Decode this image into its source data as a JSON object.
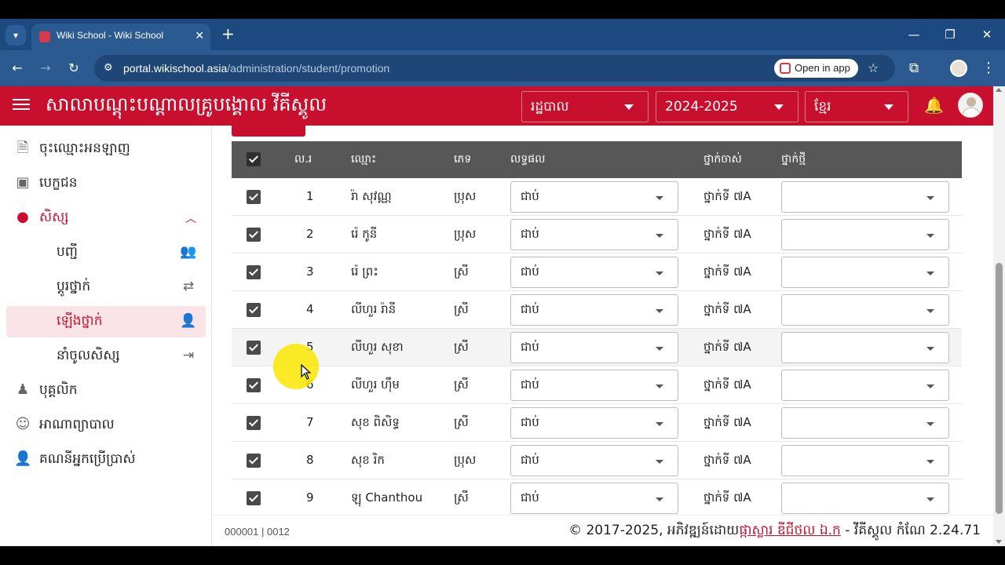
{
  "browser": {
    "tab_title": "Wiki School - Wiki School",
    "url_domain": "portal.wikischool.asia",
    "url_path": "/administration/student/promotion",
    "open_in_app": "Open in app"
  },
  "header": {
    "school_name": "សាលាបណ្តុះបណ្តាលគ្រូបង្គោល វីគីស្គូល",
    "role_select": "រដ្ឋបាល",
    "year_select": "2024-2025",
    "lang_select": "ខ្មែរ"
  },
  "sidebar": {
    "items": [
      {
        "label": "ចុះឈ្មោះអនឡាញ"
      },
      {
        "label": "បេក្ខជន"
      },
      {
        "label": "សិស្ស"
      },
      {
        "label": "បុគ្គលិក"
      },
      {
        "label": "អាណាព្យាបាល"
      },
      {
        "label": "គណនីអ្នកប្រើប្រាស់"
      }
    ],
    "sub_items": [
      {
        "label": "បញ្ជី"
      },
      {
        "label": "ប្តូរថ្នាក់"
      },
      {
        "label": "ឡើងថ្នាក់"
      },
      {
        "label": "នាំចូលសិស្ស"
      }
    ]
  },
  "table": {
    "headers": {
      "no": "ល.រ",
      "name": "ឈ្មោះ",
      "gender": "ភេទ",
      "result": "លទ្ធផល",
      "old_class": "ថ្នាក់ចាស់",
      "new_class": "ថ្នាក់ថ្មី"
    },
    "rows": [
      {
        "no": "1",
        "name": "រ៉ា សុវណ្ណ",
        "gender": "ប្រុស",
        "result": "ជាប់",
        "old_class": "ថ្នាក់ទី ៧A",
        "new_class": ""
      },
      {
        "no": "2",
        "name": "រ៉េ កូនី",
        "gender": "ប្រុស",
        "result": "ជាប់",
        "old_class": "ថ្នាក់ទី ៧A",
        "new_class": ""
      },
      {
        "no": "3",
        "name": "រ៉េ ព្រះ",
        "gender": "ស្រី",
        "result": "ជាប់",
        "old_class": "ថ្នាក់ទី ៧A",
        "new_class": ""
      },
      {
        "no": "4",
        "name": "លីហួរ រ៉ានី",
        "gender": "ស្រី",
        "result": "ជាប់",
        "old_class": "ថ្នាក់ទី ៧A",
        "new_class": ""
      },
      {
        "no": "5",
        "name": "លីហួរ សុខា",
        "gender": "ស្រី",
        "result": "ជាប់",
        "old_class": "ថ្នាក់ទី ៧A",
        "new_class": ""
      },
      {
        "no": "6",
        "name": "លីហួរ ហ៊ឹម",
        "gender": "ស្រី",
        "result": "ជាប់",
        "old_class": "ថ្នាក់ទី ៧A",
        "new_class": ""
      },
      {
        "no": "7",
        "name": "សុខ ពិសិទ្ធ",
        "gender": "ស្រី",
        "result": "ជាប់",
        "old_class": "ថ្នាក់ទី ៧A",
        "new_class": ""
      },
      {
        "no": "8",
        "name": "សុខ រិក",
        "gender": "ប្រុស",
        "result": "ជាប់",
        "old_class": "ថ្នាក់ទី ៧A",
        "new_class": ""
      },
      {
        "no": "9",
        "name": "ឡុ Chanthou",
        "gender": "ស្រី",
        "result": "ជាប់",
        "old_class": "ថ្នាក់ទី ៧A",
        "new_class": ""
      }
    ]
  },
  "footer": {
    "left": "000001 | 0012",
    "copyright_prefix": "© 2017-2025, អភិវឌ្ឍន៍ដោយ",
    "company": "ផ្កាស្លារ ឌីជីថល ឯ.ក",
    "version": " - វីគីស្គូល កំណែ 2.24.71"
  },
  "colors": {
    "brand": "#c8102e",
    "browser": "#1c4a80",
    "table_header": "#575757"
  }
}
